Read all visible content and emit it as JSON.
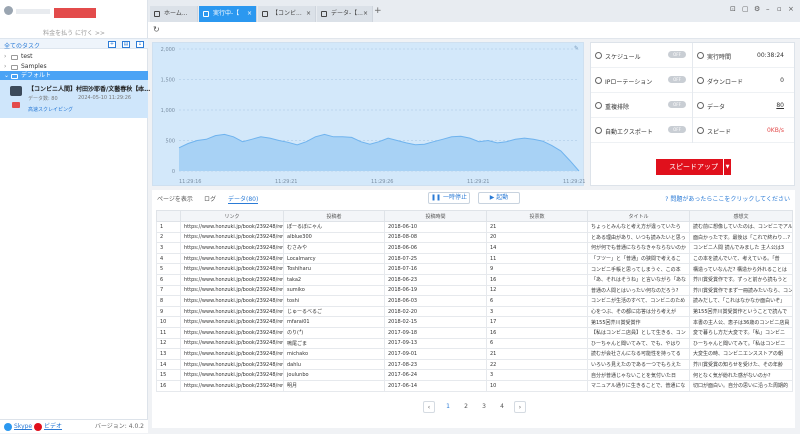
{
  "sidebar": {
    "upgrade_text": "料金を払う に行く >>",
    "section_title": "全てのタスク",
    "tree": [
      {
        "label": "test"
      },
      {
        "label": "Samples"
      },
      {
        "label": "デフォルト"
      }
    ],
    "task": {
      "title": "【コンビニ人間】村田沙耶香/文藝春秋【本…",
      "label_data": "データ数:",
      "data_count": "80",
      "date": "2024-05-10 11:29:26",
      "status": "高速スクレイピング"
    },
    "footer": {
      "skype": "Skype",
      "video": "ビデオ",
      "version": "バージョン: 4.0.2"
    }
  },
  "tabs": [
    {
      "label": "ホーム..."
    },
    {
      "label": "実行中-【"
    },
    {
      "label": "【コンビ..."
    },
    {
      "label": "データ-【..."
    }
  ],
  "chart_data": {
    "type": "area",
    "y_ticks": [
      "2,000",
      "1,500",
      "1,000",
      "500",
      "0"
    ],
    "ylim": [
      0,
      2000
    ],
    "x_ticks": [
      "11:29:16",
      "11:29:21",
      "11:29:26",
      "11:29:21",
      "11:29:21"
    ],
    "values": [
      380,
      450,
      500,
      520,
      580,
      600,
      560,
      480,
      520,
      560,
      540,
      500,
      470,
      430,
      480,
      560,
      600,
      560,
      560,
      550,
      480,
      440,
      480,
      540,
      500,
      460,
      430,
      440,
      480,
      520,
      560,
      570,
      540,
      480,
      500,
      460,
      480,
      520,
      540,
      520,
      490,
      420,
      330,
      170,
      0
    ],
    "grid": true
  },
  "stats": {
    "schedule": {
      "label": "スケジュール",
      "toggle": "OFF"
    },
    "ip_rotation": {
      "label": "IPローテーション",
      "toggle": "OFF"
    },
    "dedupe": {
      "label": "重複排除",
      "toggle": "OFF"
    },
    "auto_export": {
      "label": "自動エクスポート",
      "toggle": "OFF"
    },
    "run_time": {
      "label": "実行時間",
      "value": "00:38:24"
    },
    "download": {
      "label": "ダウンロード",
      "value": "0"
    },
    "data": {
      "label": "データ",
      "value": "80"
    },
    "speed": {
      "label": "スピード",
      "value": "0KB/s"
    },
    "speedup_button": "スピードアップ"
  },
  "data_view": {
    "tab_page": "ページを表示",
    "tab_log": "ログ",
    "tab_data": "データ(80)",
    "pause_button": "一時停止",
    "start_button": "起動",
    "help_link": "問題があったらここをクリックしてください",
    "columns": [
      "",
      "リンク",
      "投稿者",
      "投稿時間",
      "投票数",
      "タイトル",
      "感想文"
    ],
    "rows": [
      [
        "1",
        "https://www.honzuki.jp/book/239248/revie...",
        "ぽーるぼにゃん",
        "2018-06-10",
        "21",
        "ちょっとみんなと考え方が違っていたら",
        "読む前に想像していたのは、コンビニでアル"
      ],
      [
        "2",
        "https://www.honzuki.jp/book/239248/revie...",
        "alblue300",
        "2018-08-08",
        "20",
        "とある理由があり、いつも読みたいと思っ",
        "面白かったです。最後は「これで終わり…?"
      ],
      [
        "3",
        "https://www.honzuki.jp/book/239248/revie...",
        "むさみや",
        "2018-06-06",
        "14",
        "何が何でも普通にならなきゃならないのか",
        "コンビニ人間 読んでみました 主人公は3"
      ],
      [
        "4",
        "https://www.honzuki.jp/book/239248/revie...",
        "Localmarcy",
        "2018-07-25",
        "11",
        "「フツー」と「普通」の狭間で考えるこ",
        "この本を読んでいて、考えている。「普"
      ],
      [
        "5",
        "https://www.honzuki.jp/book/239248/revie...",
        "Toshiharu",
        "2018-07-16",
        "9",
        "コンビニ手帳と思ってしまうぐ、この本",
        "構造っていなんだ? 構造から外れることは"
      ],
      [
        "6",
        "https://www.honzuki.jp/book/239248/revie...",
        "taka2",
        "2018-06-23",
        "16",
        "「あ、それはそうね」と言いながら「あな",
        "芥川賞受賞作です。ずっと前から読もうと"
      ],
      [
        "7",
        "https://www.honzuki.jp/book/239248/revie...",
        "sumiko",
        "2018-06-19",
        "12",
        "普通の人間とはいったい何なのだろう?",
        "芥川賞受賞作でまず一冊読みたいなら、コン"
      ],
      [
        "8",
        "https://www.honzuki.jp/book/239248/revie...",
        "toshi",
        "2018-06-03",
        "6",
        "コンビニが生活のすべて、コンビニのため",
        "読みだして、「これはなかなか面白いぞ」"
      ],
      [
        "9",
        "https://www.honzuki.jp/book/239248/revie...",
        "じゅーるべるご",
        "2018-02-20",
        "3",
        "心をつぶ、その都に応答は分ら考えが",
        "第155回芥川賞受賞作ということで読んで"
      ],
      [
        "10",
        "https://www.honzuki.jp/book/239248/revie...",
        "mfarai01",
        "2018-02-15",
        "17",
        "第155回芥川賞受賞作",
        "本書の主人公、恵子は36歳のコンビニ店員"
      ],
      [
        "11",
        "https://www.honzuki.jp/book/239248/revie...",
        "のり(*゚)",
        "2017-09-18",
        "16",
        "【私はコンビニ店員】として生きる、コン",
        "変で暮らし方だ大変です。「私」コンビニ"
      ],
      [
        "12",
        "https://www.honzuki.jp/book/239248/revie...",
        "嗚尾ごま",
        "2017-09-13",
        "6",
        "ひーちゃんと聞いてみて、でも、やはり",
        "ひーちゃんと聞いてみて。「私はコンビニ"
      ],
      [
        "13",
        "https://www.honzuki.jp/book/239248/revie...",
        "michako",
        "2017-09-01",
        "21",
        "読むが会社さんになる可能性を持ってる",
        "大変生の時、コンビニエンスストアの朝"
      ],
      [
        "14",
        "https://www.honzuki.jp/book/239248/revie...",
        "dahlu",
        "2017-08-23",
        "22",
        "いろいろ見えたのである一つでもらえた",
        "芥川賞受賞の知らせを受けた、その年齢"
      ],
      [
        "15",
        "https://www.honzuki.jp/book/239248/revie...",
        "joulunbo",
        "2017-06-24",
        "3",
        "自分が普通じゃないことを気付いた日",
        "何となく気が紛れた感がないのか?"
      ],
      [
        "16",
        "https://www.honzuki.jp/book/239248/revie...",
        "明月",
        "2017-06-14",
        "10",
        "マニュアル通りに生きることで、普通にな",
        "切口が面白い。自分の思いに沿った周期的"
      ]
    ],
    "pages": [
      "1",
      "2",
      "3",
      "4"
    ]
  }
}
